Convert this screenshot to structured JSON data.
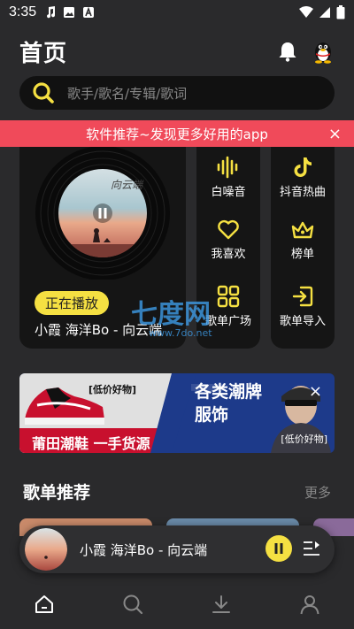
{
  "status_bar": {
    "time": "3:35",
    "left_icons": [
      "music-note-icon",
      "gallery-icon",
      "a-letter-icon"
    ],
    "right_icons": [
      "wifi-icon",
      "signal-icon",
      "battery-icon"
    ]
  },
  "header": {
    "title": "首页",
    "icons": [
      "bell-icon",
      "qq-penguin-icon"
    ]
  },
  "search": {
    "placeholder": "歌手/歌名/专辑/歌词"
  },
  "promo": {
    "text": "软件推荐~发现更多好用的app",
    "close": "×"
  },
  "player_card": {
    "badge": "正在播放",
    "song": "小霞 海洋Bo - 向云端",
    "cover_text": "向云端"
  },
  "grid": {
    "col1": [
      {
        "label": "白噪音",
        "icon": "waveform-icon"
      },
      {
        "label": "我喜欢",
        "icon": "heart-icon"
      },
      {
        "label": "歌单广场",
        "icon": "grid-icon"
      }
    ],
    "col2": [
      {
        "label": "抖音热曲",
        "icon": "tiktok-icon"
      },
      {
        "label": "榜单",
        "icon": "crown-icon"
      },
      {
        "label": "歌单导入",
        "icon": "import-icon"
      }
    ]
  },
  "watermark": {
    "text": "七度网",
    "url": "www.7do.net"
  },
  "ad": {
    "left_tag": "[低价好物]",
    "headline_left": "莆田潮鞋 一手货源",
    "headline_right_1": "各类潮牌",
    "headline_right_2": "服饰",
    "right_tag": "[低价好物]",
    "close": "×"
  },
  "section": {
    "title": "歌单推荐",
    "more": "更多"
  },
  "mini_player": {
    "song": "小霞 海洋Bo - 向云端"
  },
  "tabs": [
    {
      "icon": "home-icon"
    },
    {
      "icon": "search-icon"
    },
    {
      "icon": "download-icon"
    },
    {
      "icon": "user-icon"
    }
  ],
  "colors": {
    "accent": "#f5e042",
    "promo": "#f04a5a",
    "bg": "#2a2a2c",
    "card": "#151515"
  }
}
